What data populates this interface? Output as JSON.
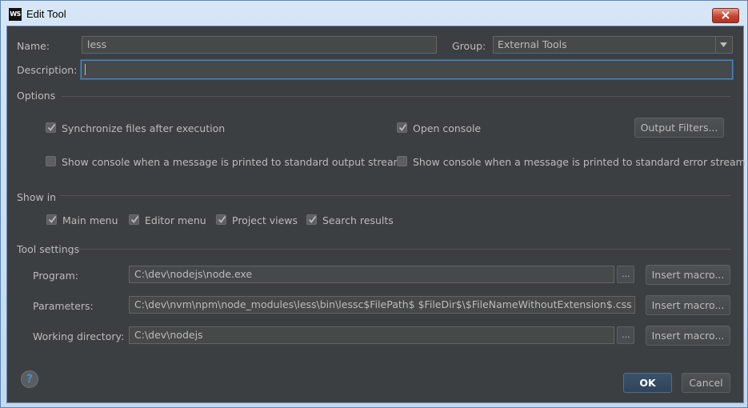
{
  "window": {
    "app_icon": "WS",
    "title": "Edit Tool"
  },
  "form": {
    "name_label": "Name:",
    "name_value": "less",
    "group_label": "Group:",
    "group_value": "External Tools",
    "description_label": "Description:",
    "description_value": ""
  },
  "options": {
    "section_label": "Options",
    "sync_files": {
      "label": "Synchronize files after execution",
      "checked": true
    },
    "open_console": {
      "label": "Open console",
      "checked": true
    },
    "output_filters_button": "Output Filters...",
    "show_console_stdout": {
      "label": "Show console when a message is printed to standard output stream",
      "checked": false
    },
    "show_console_stderr": {
      "label": "Show console when a message is printed to standard error stream",
      "checked": false
    }
  },
  "show_in": {
    "section_label": "Show in",
    "main_menu": {
      "label": "Main menu",
      "checked": true
    },
    "editor_menu": {
      "label": "Editor menu",
      "checked": true
    },
    "project_views": {
      "label": "Project views",
      "checked": true
    },
    "search_results": {
      "label": "Search results",
      "checked": true
    }
  },
  "tool_settings": {
    "section_label": "Tool settings",
    "program_label": "Program:",
    "program_value": "C:\\dev\\nodejs\\node.exe",
    "parameters_label": "Parameters:",
    "parameters_value": "C:\\dev\\nvm\\npm\\node_modules\\less\\bin\\lessc$FilePath$ $FileDir$\\$FileNameWithoutExtension$.css",
    "working_directory_label": "Working directory:",
    "working_directory_value": "C:\\dev\\nodejs",
    "browse_label": "...",
    "insert_macro_label": "Insert macro..."
  },
  "footer": {
    "help_glyph": "?",
    "ok_label": "OK",
    "cancel_label": "Cancel"
  },
  "icons": {
    "close": "close-icon",
    "dropdown": "chevron-down-icon",
    "help": "help-icon",
    "check": "check-icon"
  },
  "colors": {
    "dialog_bg": "#3c3f41",
    "field_bg": "#45494a",
    "focus_border": "#4a88c7",
    "text": "#bbbbbb",
    "close_red": "#c7432f"
  }
}
